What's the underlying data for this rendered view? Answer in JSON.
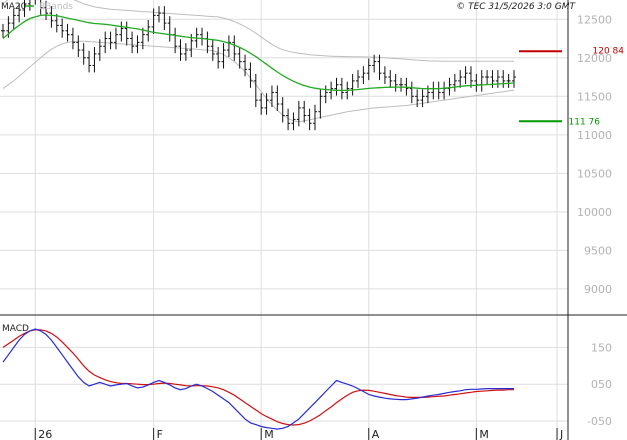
{
  "legend": {
    "ma_label": "MA20",
    "bb_label": "BBands"
  },
  "copyright": "© TEC 31/5/2026 3:0 GMT",
  "levels": {
    "resistance": {
      "label": "120 84",
      "value": 12084,
      "color": "#c00000"
    },
    "support": {
      "label": "111 76",
      "value": 11176,
      "color": "#009900"
    }
  },
  "macd_title": "MACD",
  "colors": {
    "price": "#111111",
    "ma": "#22aa22",
    "band": "#bdbdbd",
    "macd": "#2a2ad6",
    "signal": "#d01010",
    "grid": "#dddddd"
  },
  "chart_data": {
    "type": "ohlc",
    "x_ticks": [
      "26",
      "F",
      "M",
      "A",
      "M",
      "J"
    ],
    "y_ticks": [
      "12500",
      "12000",
      "11500",
      "11000",
      "10500",
      "10000",
      "9500",
      "9000"
    ],
    "ylim": [
      8700,
      12750
    ],
    "macd_ticks": [
      "150",
      "050",
      "-050"
    ],
    "macd_ylim": [
      -80,
      230
    ],
    "close": [
      12350,
      12450,
      12550,
      12620,
      12700,
      12800,
      12780,
      12650,
      12580,
      12480,
      12420,
      12350,
      12300,
      12200,
      12100,
      12000,
      11900,
      12050,
      12150,
      12250,
      12200,
      12300,
      12380,
      12250,
      12150,
      12200,
      12300,
      12400,
      12550,
      12580,
      12450,
      12300,
      12150,
      12050,
      12100,
      12220,
      12300,
      12250,
      12150,
      12050,
      11950,
      12100,
      12200,
      12050,
      11950,
      11850,
      11700,
      11450,
      11350,
      11450,
      11550,
      11400,
      11250,
      11150,
      11200,
      11350,
      11250,
      11150,
      11300,
      11500,
      11550,
      11600,
      11650,
      11550,
      11600,
      11700,
      11750,
      11800,
      11900,
      11950,
      11800,
      11750,
      11700,
      11650,
      11650,
      11600,
      11500,
      11450,
      11500,
      11550,
      11600,
      11550,
      11600,
      11650,
      11700,
      11750,
      11800,
      11700,
      11650,
      11750,
      11750,
      11700,
      11750,
      11700,
      11700,
      11750
    ],
    "ma20": [
      12250,
      12310,
      12370,
      12420,
      12470,
      12510,
      12530,
      12550,
      12555,
      12550,
      12545,
      12530,
      12515,
      12500,
      12485,
      12470,
      12455,
      12445,
      12440,
      12435,
      12425,
      12415,
      12405,
      12395,
      12385,
      12375,
      12360,
      12345,
      12330,
      12320,
      12310,
      12300,
      12290,
      12280,
      12270,
      12262,
      12255,
      12250,
      12243,
      12235,
      12225,
      12210,
      12190,
      12165,
      12135,
      12100,
      12060,
      12015,
      11965,
      11915,
      11865,
      11815,
      11770,
      11730,
      11695,
      11665,
      11640,
      11620,
      11605,
      11595,
      11588,
      11582,
      11578,
      11576,
      11578,
      11582,
      11588,
      11595,
      11602,
      11608,
      11612,
      11615,
      11618,
      11620,
      11620,
      11618,
      11612,
      11605,
      11600,
      11598,
      11598,
      11600,
      11605,
      11612,
      11620,
      11628,
      11636,
      11640,
      11643,
      11648,
      11652,
      11656,
      11660,
      11664,
      11668,
      11672
    ],
    "bb_upper": [
      12700,
      12760,
      12810,
      12850,
      12880,
      12900,
      12910,
      12905,
      12890,
      12870,
      12850,
      12820,
      12790,
      12760,
      12730,
      12700,
      12680,
      12660,
      12650,
      12640,
      12630,
      12625,
      12620,
      12615,
      12610,
      12605,
      12600,
      12595,
      12590,
      12585,
      12580,
      12575,
      12570,
      12565,
      12560,
      12555,
      12550,
      12545,
      12540,
      12535,
      12530,
      12515,
      12495,
      12470,
      12440,
      12405,
      12365,
      12320,
      12270,
      12220,
      12175,
      12135,
      12105,
      12085,
      12070,
      12060,
      12050,
      12040,
      12035,
      12030,
      12025,
      12020,
      12018,
      12016,
      12015,
      12014,
      12013,
      12012,
      12010,
      12008,
      12005,
      12000,
      11995,
      11990,
      11985,
      11980,
      11975,
      11970,
      11965,
      11960,
      11958,
      11957,
      11956,
      11955,
      11955,
      11955,
      11955,
      11955,
      11955,
      11955,
      11955,
      11955,
      11955,
      11955,
      11955,
      11955
    ],
    "bb_lower": [
      11600,
      11650,
      11700,
      11760,
      11820,
      11880,
      11940,
      12000,
      12060,
      12110,
      12150,
      12180,
      12200,
      12210,
      12215,
      12215,
      12210,
      12205,
      12200,
      12195,
      12190,
      12185,
      12180,
      12175,
      12170,
      12165,
      12160,
      12155,
      12150,
      12145,
      12140,
      12135,
      12130,
      12125,
      12120,
      12115,
      12110,
      12105,
      12100,
      12090,
      12070,
      12040,
      12000,
      11950,
      11890,
      11820,
      11740,
      11650,
      11560,
      11470,
      11390,
      11320,
      11260,
      11210,
      11180,
      11170,
      11180,
      11195,
      11210,
      11225,
      11240,
      11255,
      11270,
      11285,
      11300,
      11310,
      11320,
      11330,
      11340,
      11348,
      11355,
      11360,
      11365,
      11370,
      11375,
      11380,
      11390,
      11400,
      11410,
      11420,
      11430,
      11440,
      11450,
      11460,
      11470,
      11480,
      11490,
      11500,
      11510,
      11520,
      11530,
      11540,
      11550,
      11560,
      11570,
      11580
    ],
    "macd": [
      110,
      130,
      150,
      170,
      185,
      195,
      200,
      195,
      185,
      170,
      150,
      130,
      110,
      90,
      70,
      55,
      45,
      50,
      55,
      50,
      45,
      48,
      50,
      52,
      45,
      40,
      42,
      48,
      55,
      60,
      55,
      48,
      40,
      35,
      38,
      45,
      50,
      45,
      38,
      30,
      20,
      10,
      0,
      -15,
      -30,
      -45,
      -55,
      -60,
      -65,
      -68,
      -70,
      -72,
      -70,
      -65,
      -55,
      -45,
      -30,
      -15,
      0,
      15,
      30,
      45,
      60,
      55,
      50,
      45,
      38,
      30,
      22,
      18,
      15,
      12,
      10,
      9,
      8,
      8,
      10,
      12,
      15,
      18,
      20,
      22,
      25,
      28,
      30,
      32,
      35,
      36,
      36,
      37,
      38,
      38,
      38,
      38,
      38,
      38
    ],
    "signal": [
      150,
      160,
      170,
      180,
      188,
      195,
      198,
      198,
      195,
      188,
      178,
      165,
      150,
      135,
      118,
      100,
      85,
      75,
      68,
      62,
      57,
      54,
      52,
      52,
      51,
      50,
      49,
      49,
      50,
      52,
      53,
      52,
      50,
      48,
      46,
      45,
      46,
      46,
      45,
      43,
      40,
      35,
      28,
      20,
      10,
      0,
      -10,
      -20,
      -30,
      -38,
      -45,
      -52,
      -57,
      -60,
      -61,
      -60,
      -56,
      -50,
      -42,
      -33,
      -22,
      -12,
      0,
      10,
      20,
      28,
      32,
      34,
      33,
      31,
      28,
      25,
      22,
      19,
      17,
      15,
      14,
      14,
      14,
      15,
      16,
      17,
      18,
      20,
      22,
      24,
      26,
      28,
      30,
      31,
      32,
      33,
      34,
      34,
      35,
      35
    ]
  }
}
